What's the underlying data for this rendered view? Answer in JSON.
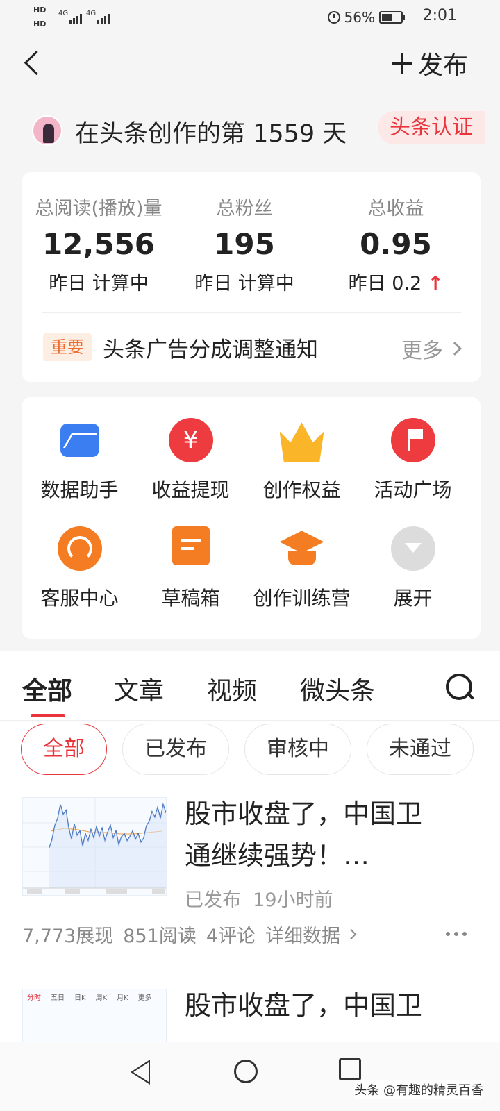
{
  "status_bar": {
    "hd1": "HD",
    "hd2": "HD",
    "sig1": "4G",
    "sig2": "4G",
    "battery": "56%",
    "time": "2:01"
  },
  "header": {
    "publish_label": "发布"
  },
  "creator": {
    "days_text": "在头条创作的第 1559 天",
    "verify_label": "头条认证"
  },
  "stats": [
    {
      "label": "总阅读(播放)量",
      "value": "12,556",
      "sub": "昨日 计算中"
    },
    {
      "label": "总粉丝",
      "value": "195",
      "sub": "昨日 计算中"
    },
    {
      "label": "总收益",
      "value": "0.95",
      "sub": "昨日 0.2",
      "trend": "↑"
    }
  ],
  "notice": {
    "tag": "重要",
    "text": "头条广告分成调整通知",
    "more": "更多"
  },
  "tools": [
    {
      "label": "数据助手",
      "icon": "data-chart-icon"
    },
    {
      "label": "收益提现",
      "icon": "yuan-icon",
      "glyph": "¥"
    },
    {
      "label": "创作权益",
      "icon": "crown-icon"
    },
    {
      "label": "活动广场",
      "icon": "flag-icon"
    },
    {
      "label": "客服中心",
      "icon": "headset-icon"
    },
    {
      "label": "草稿箱",
      "icon": "draft-icon"
    },
    {
      "label": "创作训练营",
      "icon": "graduation-cap-icon"
    },
    {
      "label": "展开",
      "icon": "expand-icon"
    }
  ],
  "tabs": [
    "全部",
    "文章",
    "视频",
    "微头条"
  ],
  "filters": [
    "全部",
    "已发布",
    "审核中",
    "未通过"
  ],
  "articles": [
    {
      "title_line1": "股市收盘了，中国卫",
      "title_line2": "通继续强势！…",
      "status": "已发布",
      "time": "19小时前",
      "impressions": "7,773展现",
      "reads": "851阅读",
      "comments": "4评论",
      "detail": "详细数据"
    },
    {
      "title_line1": "股市收盘了，中国卫",
      "thumb_tabs": [
        "分时",
        "五日",
        "日K",
        "周K",
        "月K",
        "更多"
      ]
    }
  ],
  "watermark": "头条 @有趣的精灵百香",
  "colors": {
    "accent": "#e8343a",
    "orange": "#f47c22",
    "blue": "#3a7ef2",
    "gold": "#fbb528"
  }
}
